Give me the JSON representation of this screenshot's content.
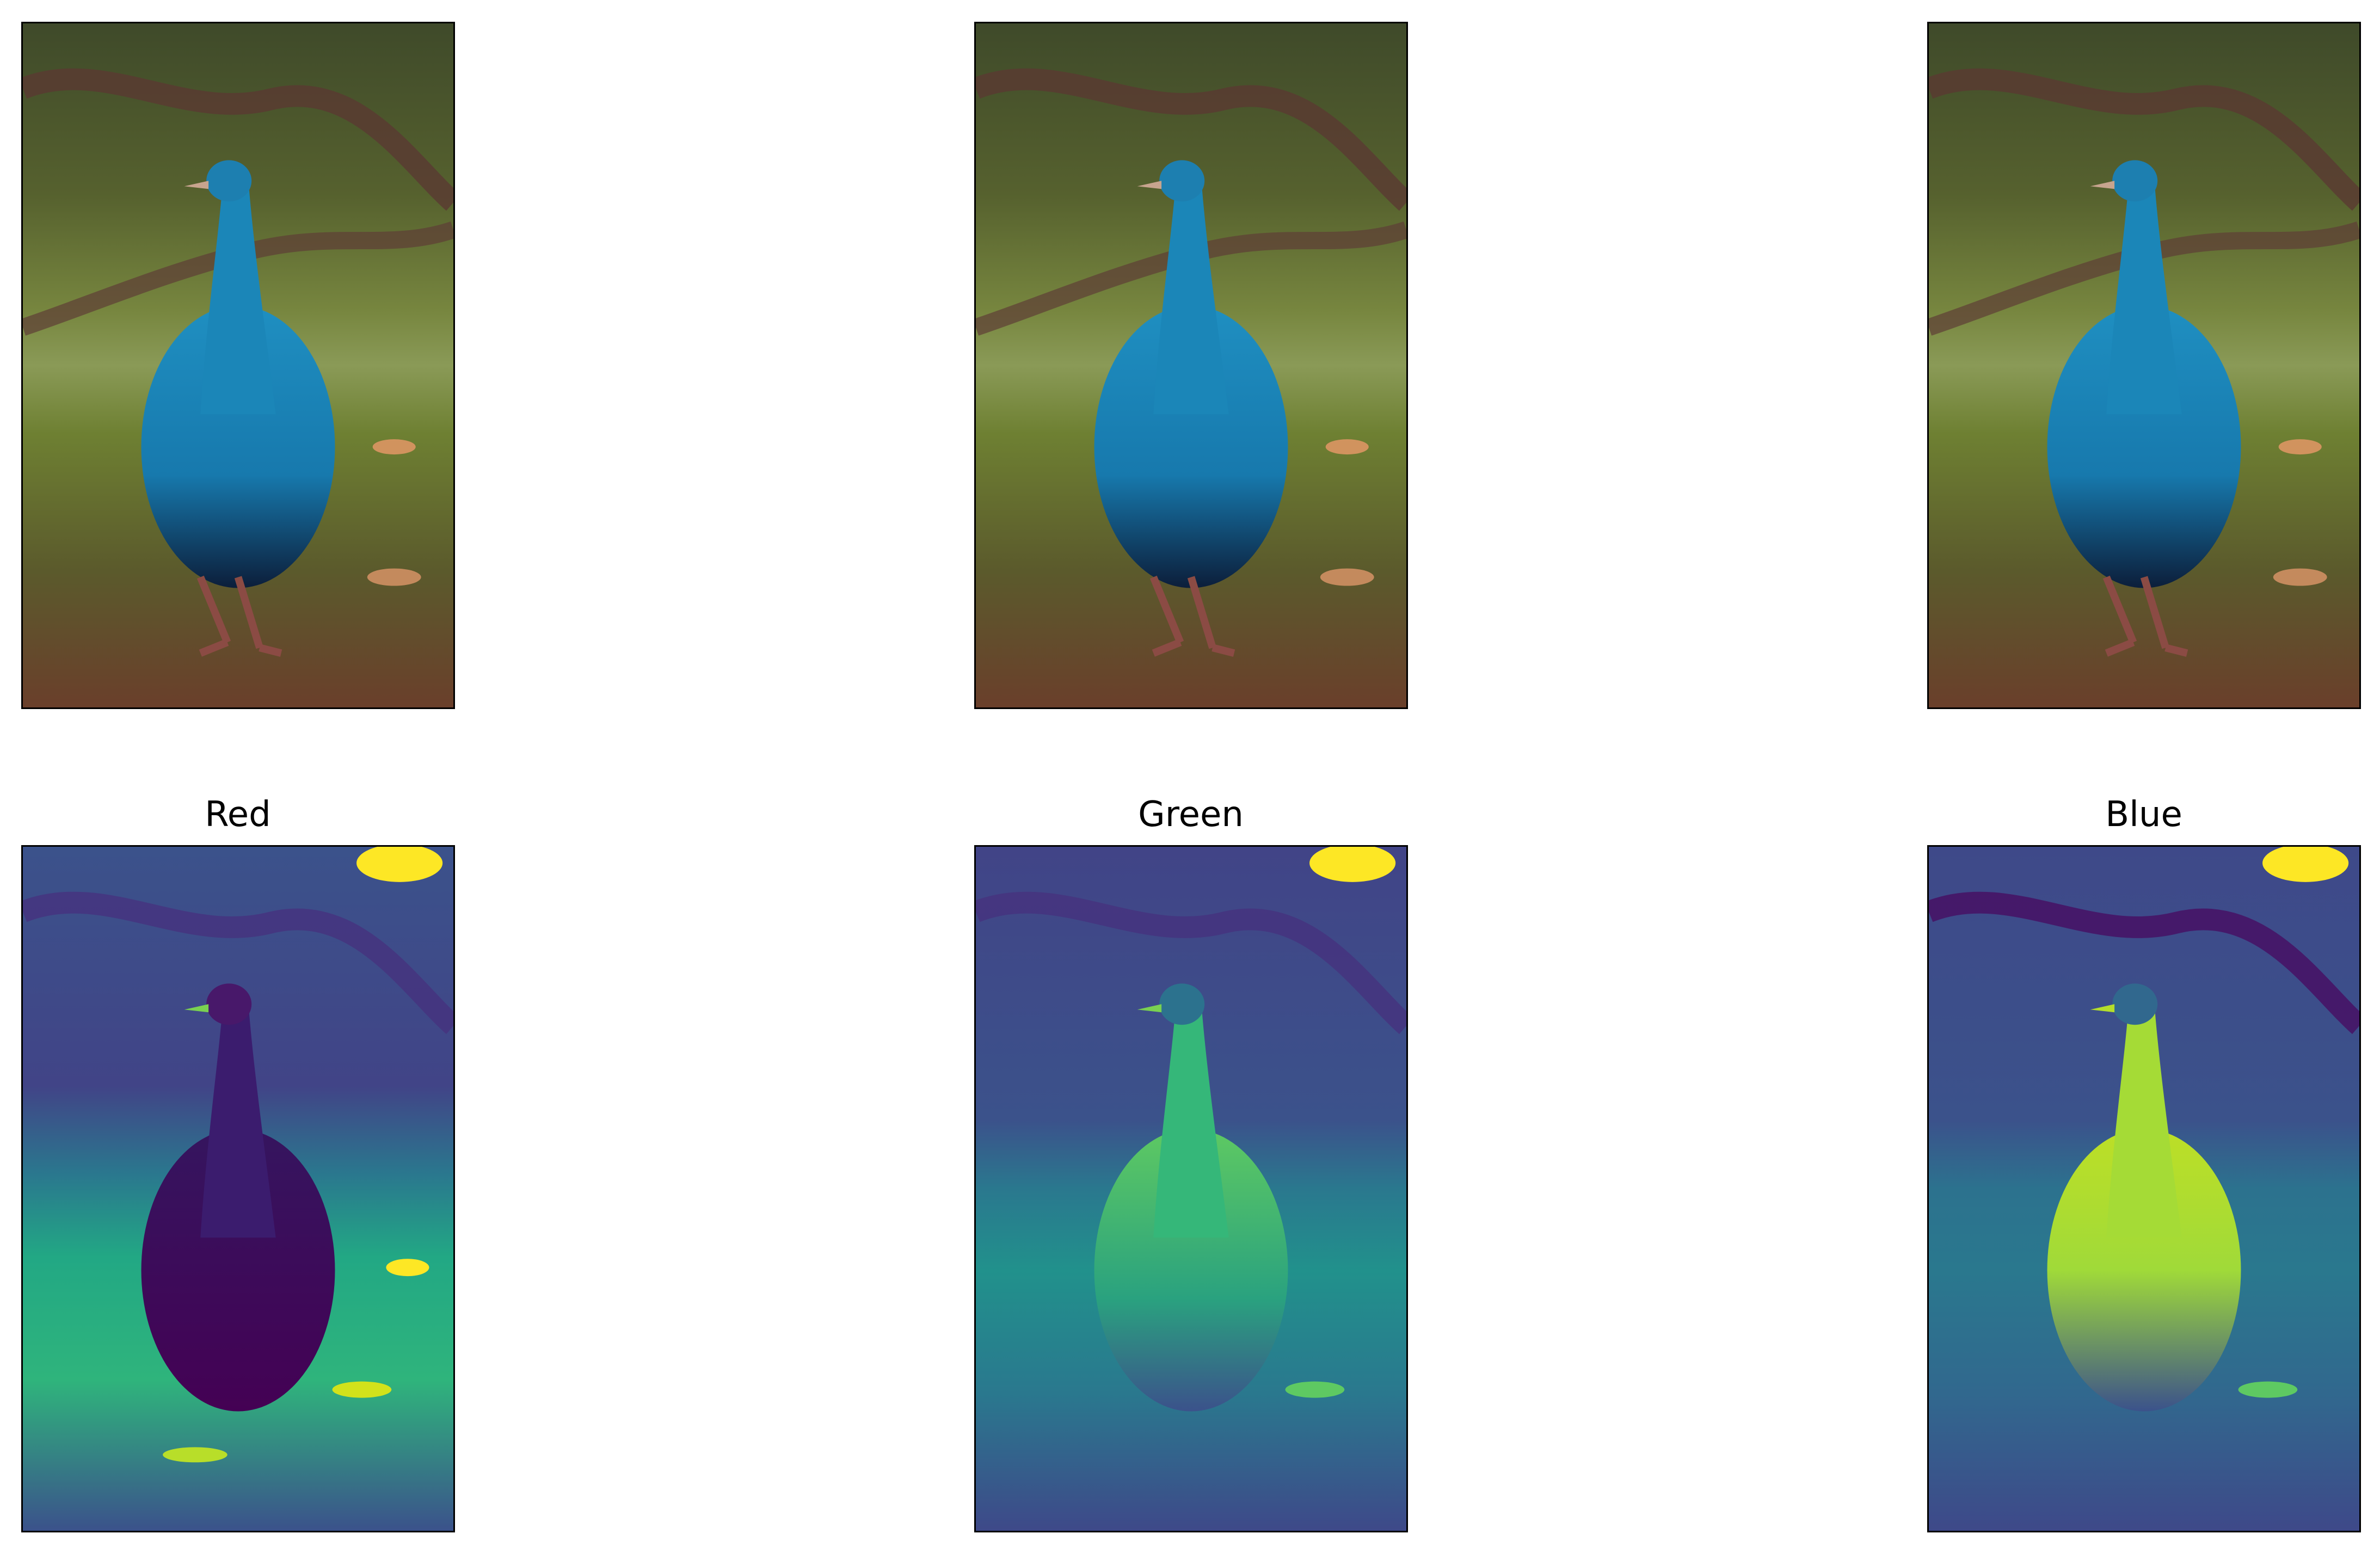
{
  "figure": {
    "top_row": [
      {
        "caption": "",
        "image": "peacock-color-photo"
      },
      {
        "caption": "",
        "image": "peacock-color-photo"
      },
      {
        "caption": "",
        "image": "peacock-color-photo"
      }
    ],
    "bottom_row": [
      {
        "caption": "Red",
        "image": "peacock-red-channel-viridis"
      },
      {
        "caption": "Green",
        "image": "peacock-green-channel-viridis"
      },
      {
        "caption": "Blue",
        "image": "peacock-blue-channel-viridis"
      }
    ],
    "colormap": "viridis",
    "colors": {
      "viridis_dark": "#440154",
      "viridis_mid": "#21918c",
      "viridis_light": "#fde725"
    }
  }
}
